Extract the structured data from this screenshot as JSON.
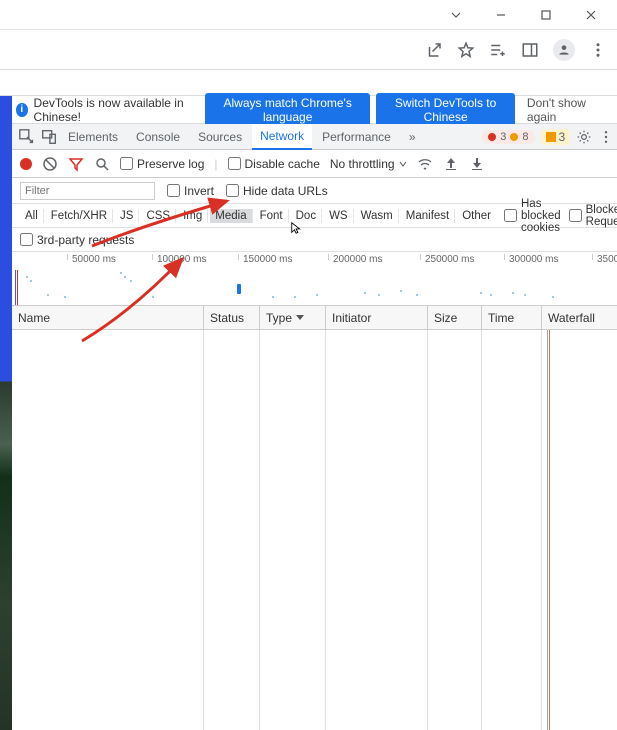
{
  "infobar": {
    "message": "DevTools is now available in Chinese!",
    "btn_always": "Always match Chrome's language",
    "btn_switch": "Switch DevTools to Chinese",
    "dont_show": "Don't show again"
  },
  "tabs": {
    "elements": "Elements",
    "console": "Console",
    "sources": "Sources",
    "network": "Network",
    "performance": "Performance"
  },
  "counts": {
    "errors": "3",
    "warnings": "8",
    "issues": "3"
  },
  "nettools": {
    "preserve": "Preserve log",
    "disable_cache": "Disable cache",
    "throttling": "No throttling"
  },
  "filter": {
    "placeholder": "Filter",
    "invert": "Invert",
    "hide_data": "Hide data URLs"
  },
  "types": {
    "all": "All",
    "fetch": "Fetch/XHR",
    "js": "JS",
    "css": "CSS",
    "img": "Img",
    "media": "Media",
    "font": "Font",
    "doc": "Doc",
    "ws": "WS",
    "wasm": "Wasm",
    "manifest": "Manifest",
    "other": "Other",
    "blocked_cookies": "Has blocked cookies",
    "blocked_requests": "Blocked Requests"
  },
  "third_party": "3rd-party requests",
  "timeline": {
    "t1": "50000 ms",
    "t2": "100000 ms",
    "t3": "150000 ms",
    "t4": "200000 ms",
    "t5": "250000 ms",
    "t6": "300000 ms",
    "t7": "3500"
  },
  "columns": {
    "name": "Name",
    "status": "Status",
    "type": "Type",
    "initiator": "Initiator",
    "size": "Size",
    "time": "Time",
    "waterfall": "Waterfall"
  }
}
